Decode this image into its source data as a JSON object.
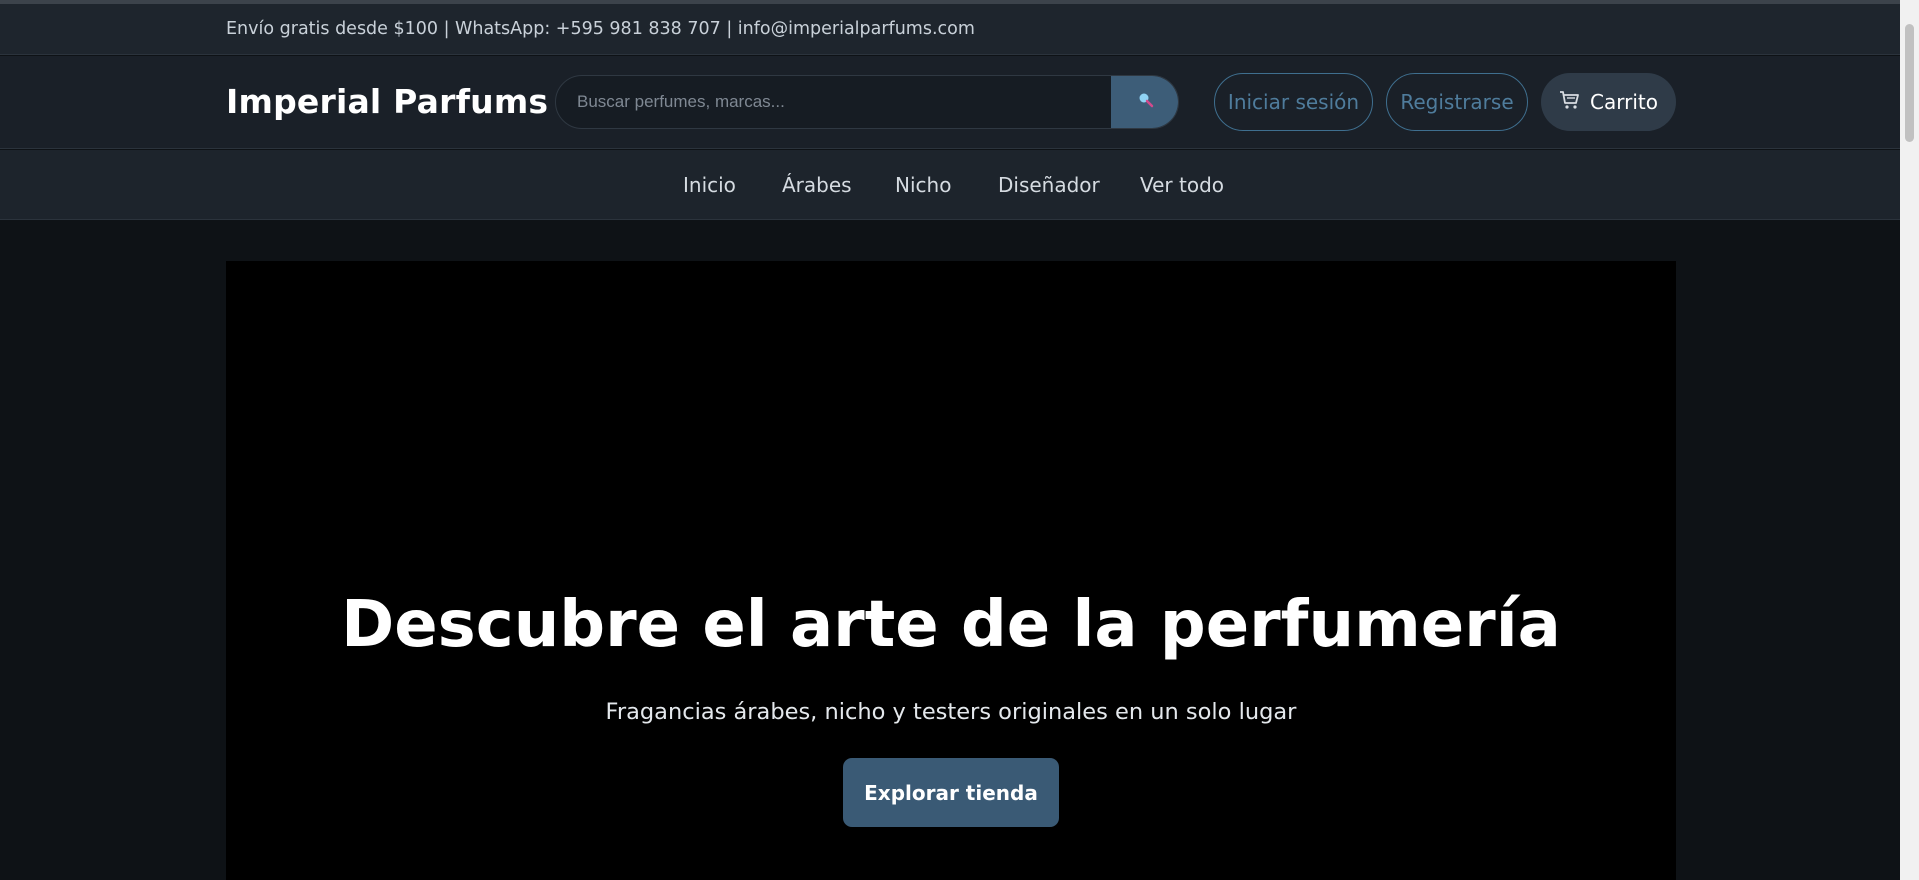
{
  "topbar": {
    "info_text": "Envío gratis desde $100 | WhatsApp: +595 981 838 707 | info@imperialparfums.com"
  },
  "header": {
    "logo": "Imperial Parfums",
    "search_placeholder": "Buscar perfumes, marcas...",
    "search_icon": "search-icon",
    "login_label": "Iniciar sesión",
    "register_label": "Registrarse",
    "cart_label": "Carrito",
    "cart_icon": "cart-icon"
  },
  "nav": {
    "items": [
      {
        "label": "Inicio"
      },
      {
        "label": "Árabes"
      },
      {
        "label": "Nicho"
      },
      {
        "label": "Diseñador"
      },
      {
        "label": "Ver todo"
      }
    ]
  },
  "hero": {
    "title": "Descubre el arte de la perfumería",
    "subtitle": "Fragancias árabes, nicho y testers originales en un solo lugar",
    "cta_label": "Explorar tienda"
  },
  "colors": {
    "page_background": "#0e1216",
    "header_background": "#1a2028",
    "accent": "#3d5d78",
    "outline_button": "#4f7c9c",
    "hero_background": "#000000"
  }
}
